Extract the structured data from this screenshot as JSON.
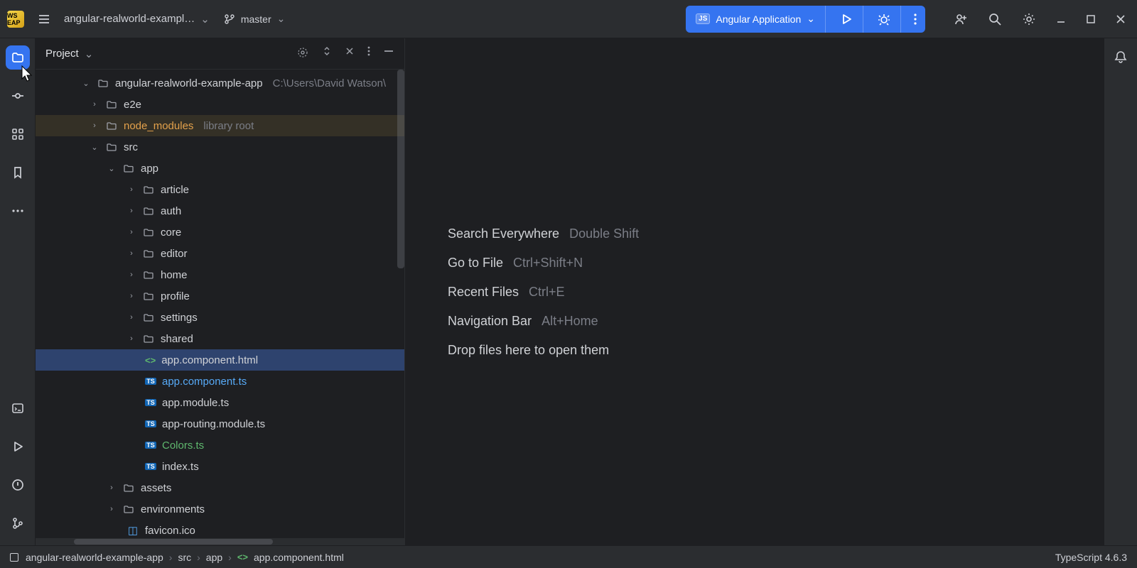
{
  "titlebar": {
    "app_badge": "WS EAP",
    "project_name": "angular-realworld-exampl…",
    "branch": "master",
    "run_config": "Angular Application"
  },
  "project_panel": {
    "title": "Project",
    "root": {
      "name": "angular-realworld-example-app",
      "path": "C:\\Users\\David Watson\\"
    },
    "tree": {
      "e2e": "e2e",
      "node_modules": "node_modules",
      "node_modules_note": "library root",
      "src": "src",
      "app": "app",
      "folders": [
        "article",
        "auth",
        "core",
        "editor",
        "home",
        "profile",
        "settings",
        "shared"
      ],
      "files": {
        "app_component_html": "app.component.html",
        "app_component_ts": "app.component.ts",
        "app_module_ts": "app.module.ts",
        "app_routing_module_ts": "app-routing.module.ts",
        "colors_ts": "Colors.ts",
        "index_ts": "index.ts"
      },
      "assets": "assets",
      "environments": "environments",
      "favicon": "favicon.ico"
    }
  },
  "editor_hints": [
    {
      "label": "Search Everywhere",
      "shortcut": "Double Shift"
    },
    {
      "label": "Go to File",
      "shortcut": "Ctrl+Shift+N"
    },
    {
      "label": "Recent Files",
      "shortcut": "Ctrl+E"
    },
    {
      "label": "Navigation Bar",
      "shortcut": "Alt+Home"
    },
    {
      "label": "Drop files here to open them",
      "shortcut": ""
    }
  ],
  "breadcrumbs": [
    "angular-realworld-example-app",
    "src",
    "app",
    "app.component.html"
  ],
  "status": {
    "typescript": "TypeScript 4.6.3"
  }
}
